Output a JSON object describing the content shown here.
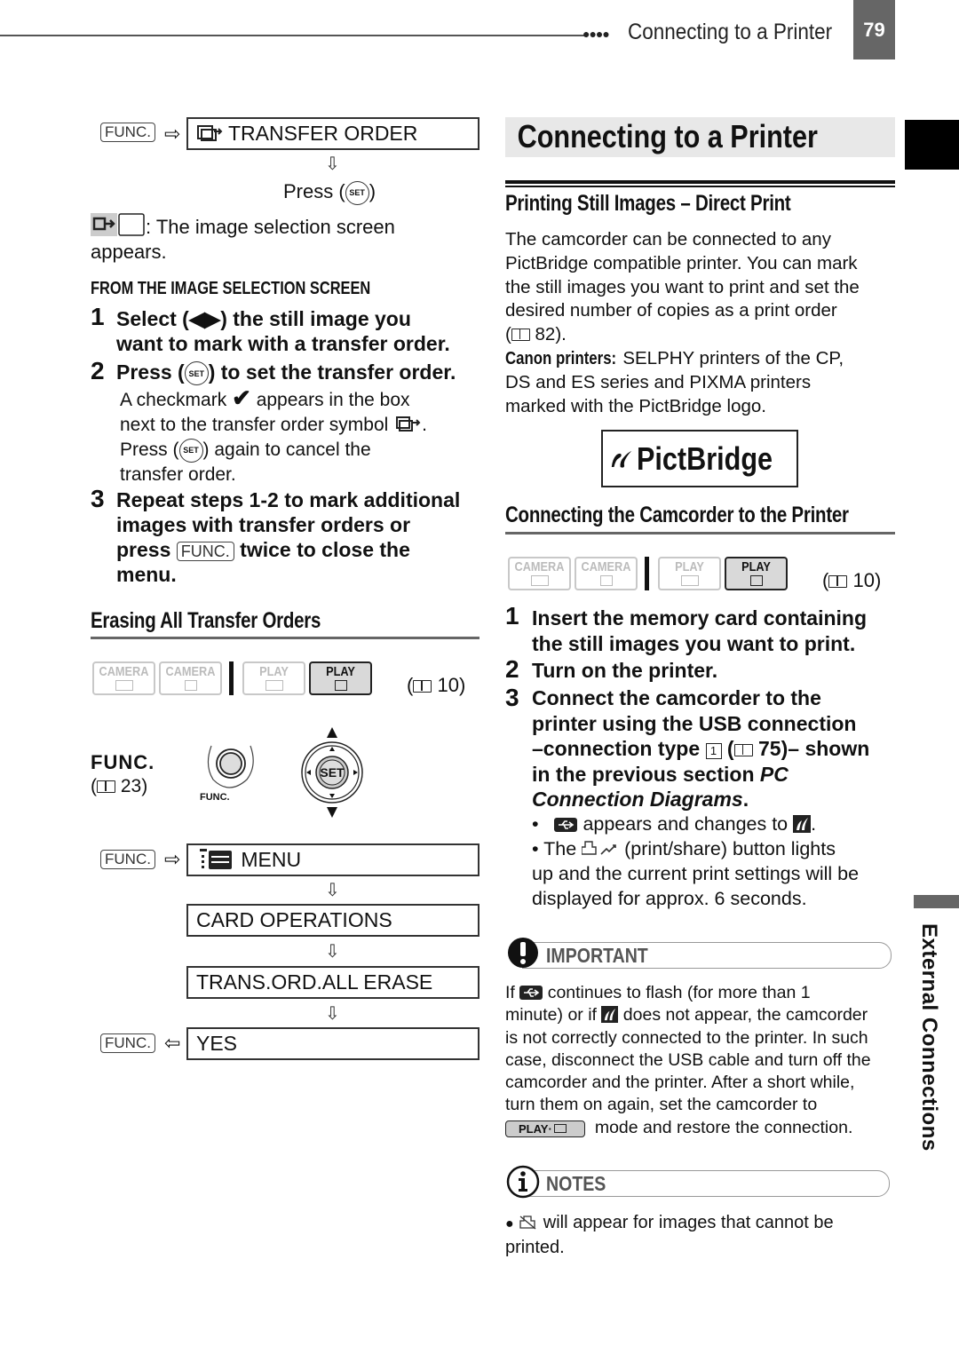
{
  "header": {
    "section_title": "Connecting to a Printer",
    "page_number": "79",
    "dots": "●●●●"
  },
  "side_tab": {
    "label": "External Connections"
  },
  "left": {
    "func_key": "FUNC.",
    "flow1": {
      "box": "TRANSFER ORDER",
      "press_prefix": "Press (",
      "press_suffix": ")",
      "set_label": "SET",
      "selection_note_1": ": The image selection screen",
      "selection_note_2": "appears."
    },
    "subheading": "FROM THE IMAGE SELECTION SCREEN",
    "steps": [
      {
        "num": "1",
        "lines": [
          "Select (◀▶) the still image you",
          "want to mark with a transfer order."
        ]
      },
      {
        "num": "2",
        "text_a": "Press (",
        "text_b": ") to set the transfer order."
      },
      {
        "num": "3",
        "lines": [
          "Repeat steps 1-2 to mark additional",
          "images with transfer orders or"
        ],
        "line3_a": "press",
        "line3_b": "twice to close the",
        "line4": "menu."
      }
    ],
    "step2_detail": {
      "line1_a": "A checkmark",
      "line1_b": "appears in the box",
      "line2": "next to the transfer order symbol",
      "line2_end": ".",
      "line3_a": "Press (",
      "line3_b": ") again to cancel the",
      "line4": "transfer order."
    },
    "erase_heading": "Erasing All Transfer Orders",
    "modes": [
      {
        "label": "CAMERA",
        "media": "tape",
        "active": false
      },
      {
        "label": "CAMERA",
        "media": "card",
        "active": false
      },
      {
        "label": "PLAY",
        "media": "tape",
        "active": false
      },
      {
        "label": "PLAY",
        "media": "card",
        "active": true
      }
    ],
    "mode_ref": "10",
    "func_caption": "FUNC.",
    "func_ref": "23",
    "func_button_label": "FUNC.",
    "joystick_label": "SET",
    "flow2": [
      {
        "label": "MENU",
        "icon": "menu-icon"
      },
      {
        "label": "CARD OPERATIONS"
      },
      {
        "label": "TRANS.ORD.ALL ERASE"
      },
      {
        "label": "YES"
      }
    ]
  },
  "right": {
    "title": "Connecting to a Printer",
    "heading1": "Printing Still Images – Direct Print",
    "intro": [
      "The camcorder can be connected to any",
      "PictBridge compatible printer. You can mark",
      "the still images you want to print and set the",
      "desired number of copies as a print order"
    ],
    "intro_ref": "82",
    "canon_label": "Canon printers:",
    "canon_text": [
      " SELPHY printers of the CP,",
      "DS and ES series and PIXMA printers",
      "marked with the PictBridge logo."
    ],
    "logo_text": "PictBridge",
    "heading2": "Connecting the Camcorder to the Printer",
    "mode_ref": "10",
    "steps": [
      {
        "num": "1",
        "lines": [
          "Insert the memory card containing",
          "the still images you want to print."
        ]
      },
      {
        "num": "2",
        "lines": [
          "Turn on the printer."
        ]
      },
      {
        "num": "3",
        "lines": [
          "Connect the camcorder to the",
          "printer using the USB connection"
        ],
        "line3_a": "–connection type",
        "line3_box": "1",
        "line3_ref": "75",
        "line3_b": "– shown",
        "line4_a": "in the previous section",
        "line4_italic": "PC",
        "line5_italic": "Connection Diagrams",
        "line5_end": "."
      }
    ],
    "bullets": {
      "b1_mid": "appears and changes to",
      "b2_a": "• The",
      "b2_b": "(print/share) button lights",
      "b2_c": "up and the current print settings will be",
      "b2_d": "displayed for approx. 6 seconds."
    },
    "important": {
      "label": "IMPORTANT",
      "l1_a": "If",
      "l1_b": "continues to flash (for more than 1",
      "l2_a": "minute) or if",
      "l2_b": "does not appear, the camcorder",
      "l3": "is not correctly connected to the printer. In such",
      "l4": "case, disconnect the USB cable and turn off the",
      "l5": "camcorder and the printer. After a short while,",
      "l6": "turn them on again, set the camcorder to",
      "mode_badge": "PLAY·",
      "l7": "mode and restore the connection."
    },
    "notes": {
      "label": "NOTES",
      "l1": "will appear for images that cannot be",
      "l2": "printed."
    }
  }
}
